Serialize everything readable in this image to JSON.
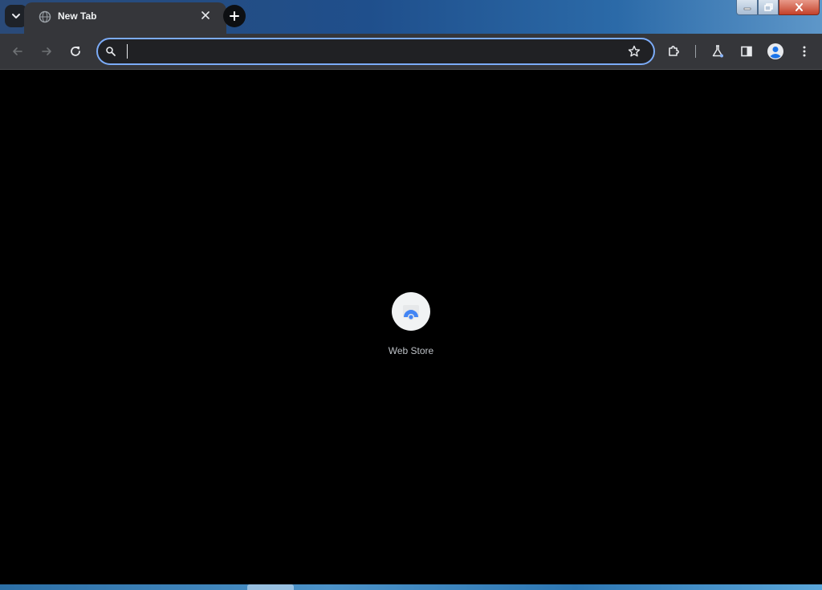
{
  "tab": {
    "title": "New Tab",
    "close_label": "×"
  },
  "omnibox": {
    "value": "",
    "placeholder": ""
  },
  "shortcuts": [
    {
      "label": "Web Store",
      "icon": "web-store-icon"
    }
  ],
  "colors": {
    "accent": "#7cacf8",
    "toolbar": "#35363a",
    "background": "#000000"
  }
}
